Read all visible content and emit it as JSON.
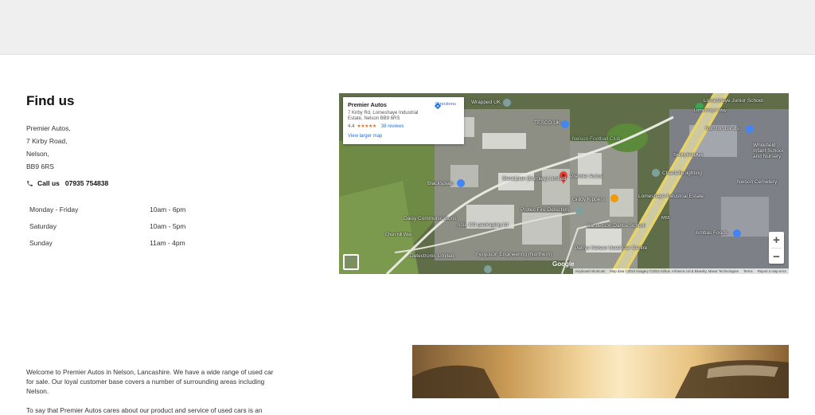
{
  "find_us": {
    "title": "Find us",
    "address_lines": [
      "Premier Autos,",
      "7 Kirby Road,",
      "Nelson,",
      "BB9 6RS"
    ],
    "call_label": "Call us",
    "phone": "07935 754838",
    "hours": [
      {
        "day": "Monday - Friday",
        "time": "10am - 6pm"
      },
      {
        "day": "Saturday",
        "time": "10am - 5pm"
      },
      {
        "day": "Sunday",
        "time": "11am - 4pm"
      }
    ]
  },
  "map": {
    "place_name": "Premier Autos",
    "place_address": "7 Kirby Rd, Lomeshaye Industrial Estate, Nelson BB9 6RS",
    "rating": "4.4",
    "stars": "★★★★★",
    "reviews": "38 reviews",
    "directions": "Directions",
    "view_larger": "View larger map",
    "zoom_in": "+",
    "zoom_out": "−",
    "google_logo": "Google",
    "attribution": [
      "Keyboard shortcuts",
      "Map data ©2024 Imagery ©2024 Airbus, Infoterra Ltd & Bluesky, Maxar Technologies",
      "Terms",
      "Report a map error"
    ],
    "labels": {
      "wrapped_uk": "Wrapped UK",
      "nelson_fc": "Nelson Football Club",
      "comfort_blinds": "Comfort Blinds",
      "premier_autos": "Premier Autos",
      "steadplan": "Steadplan (Burnley) Limited",
      "giddy_kippers": "Giddy Kippers",
      "lomeshaye_estate": "Lomeshaye Industrial Estate",
      "chantelle": "Chantelle lighting",
      "blacksplain": "Blacksplain",
      "protec": "Protec Fire Detection",
      "sanderson": "Sanderson Dance School",
      "daisy": "Daisy Communications",
      "sgl": "SGL CO packaging ltd",
      "detectronic": "Detectronic Limited",
      "ferguson": "Ferguson Engineering (Northern)",
      "perrys": "Perrys Nelson Used Car Centre",
      "ambas": "Ambas Foods",
      "lomeshaye_junior": "Lomeshaye Junior School",
      "whitefield": "Whitefield Infant School and Nursery",
      "cemetery": "Nelson Cemetery",
      "tesco": "TESCO UK",
      "m65": "M65",
      "road_lomeshaye": "Lomeshaye Way",
      "road_churchill": "Churchill Way",
      "road_smithy": "Smithyfield Ave"
    }
  },
  "intro": {
    "paragraph1": "Welcome to Premier Autos in Nelson, Lancashire. We have a wide range of used car for sale. Our loyal customer base covers a number of surrounding areas including Nelson.",
    "paragraph2": "To say that Premier Autos cares about our product and service of used cars is an"
  },
  "colors": {
    "top_band": "#efefef",
    "link_blue": "#1a73e8",
    "star_orange": "#e7711b",
    "pin_red": "#ea4335"
  }
}
